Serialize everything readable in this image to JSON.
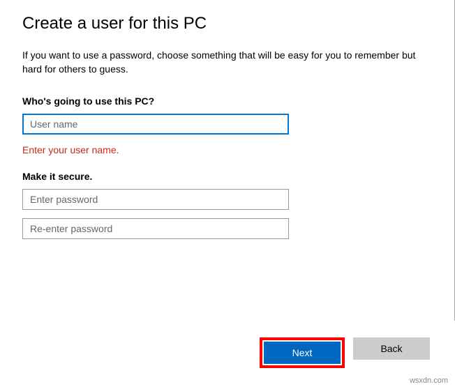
{
  "title": "Create a user for this PC",
  "description": "If you want to use a password, choose something that will be easy for you to remember but hard for others to guess.",
  "username_section": {
    "label": "Who's going to use this PC?",
    "placeholder": "User name",
    "error": "Enter your user name."
  },
  "password_section": {
    "label": "Make it secure.",
    "password_placeholder": "Enter password",
    "confirm_placeholder": "Re-enter password"
  },
  "buttons": {
    "next": "Next",
    "back": "Back"
  },
  "watermark": "wsxdn.com"
}
